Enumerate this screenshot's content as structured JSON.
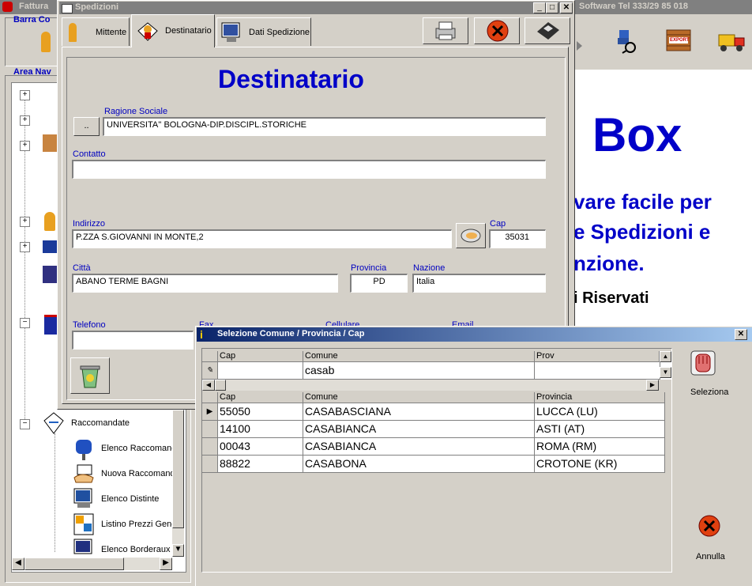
{
  "main_window": {
    "title_left": "Fattura",
    "title_right": "Software  Tel 333/29 85 018",
    "barra_label": "Barra Co",
    "area_nav_label": "Area Nav",
    "banner_big": "Box",
    "banner_line1": "vare facile per",
    "banner_line2": "e Spedizioni e",
    "banner_line3": "nzione.",
    "banner_line4": "i Riservati",
    "export_label": "EXPORT"
  },
  "tree": {
    "raccomandate": "Raccomandate",
    "items": [
      "Elenco Raccomand",
      "Nuova Raccomand",
      "Elenco Distinte",
      "Listino Prezzi Gene",
      "Elenco Borderaux"
    ]
  },
  "spedizioni": {
    "title": "Spedizioni",
    "tabs": [
      "Mittente",
      "Destinatario",
      "Dati Spedizione"
    ],
    "heading": "Destinatario",
    "ragione_label": "Ragione Sociale",
    "ragione_value": "UNIVERSITA'' BOLOGNA-DIP.DISCIPL.STORICHE",
    "browse_label": "..",
    "contatto_label": "Contatto",
    "contatto_value": "",
    "indirizzo_label": "Indirizzo",
    "indirizzo_value": "P.ZZA S.GIOVANNI IN MONTE,2",
    "cap_label": "Cap",
    "cap_value": "35031",
    "citta_label": "Città",
    "citta_value": "ABANO TERME BAGNI",
    "provincia_label": "Provincia",
    "provincia_value": "PD",
    "nazione_label": "Nazione",
    "nazione_value": "Italia",
    "telefono_label": "Telefono",
    "fax_label": "Fax",
    "cellulare_label": "Cellulare",
    "email_label": "Email"
  },
  "selezione": {
    "title": "Selezione Comune / Provincia / Cap",
    "filter_headers": [
      "Cap",
      "Comune",
      "Prov"
    ],
    "filter_values": [
      "",
      "casab",
      ""
    ],
    "result_headers": [
      "Cap",
      "Comune",
      "Provincia"
    ],
    "rows": [
      {
        "cap": "55050",
        "comune": "CASABASCIANA",
        "provincia": "LUCCA (LU)"
      },
      {
        "cap": "14100",
        "comune": "CASABIANCA",
        "provincia": "ASTI (AT)"
      },
      {
        "cap": "00043",
        "comune": "CASABIANCA",
        "provincia": "ROMA (RM)"
      },
      {
        "cap": "88822",
        "comune": "CASABONA",
        "provincia": "CROTONE (KR)"
      }
    ],
    "seleziona_label": "Seleziona",
    "annulla_label": "Annulla"
  }
}
